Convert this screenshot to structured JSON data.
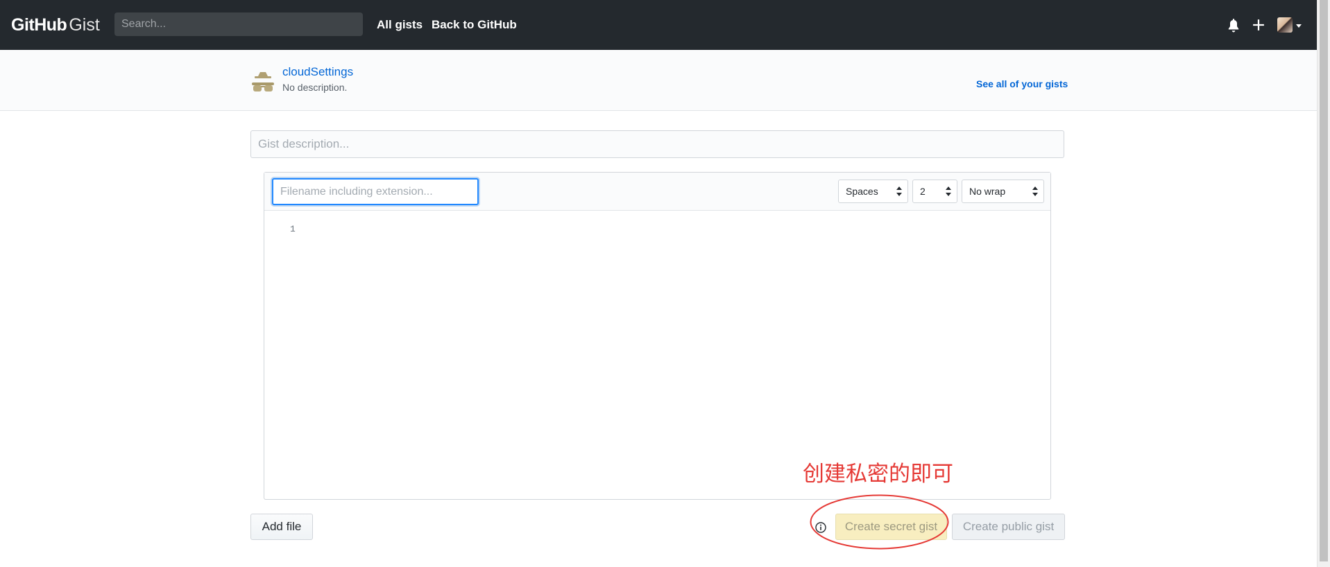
{
  "header": {
    "logo_github": "GitHub",
    "logo_gist": "Gist",
    "search_placeholder": "Search...",
    "nav": {
      "all_gists": "All gists",
      "back": "Back to GitHub"
    },
    "icons": [
      "bell-icon",
      "plus-icon",
      "avatar",
      "chevron-down-icon"
    ]
  },
  "gist": {
    "name": "cloudSettings",
    "description": "No description.",
    "see_all": "See all of your gists"
  },
  "form": {
    "description_placeholder": "Gist description...",
    "filename_placeholder": "Filename including extension...",
    "indent_mode": "Spaces",
    "indent_size": "2",
    "wrap_mode": "No wrap",
    "line_numbers": [
      "1"
    ]
  },
  "buttons": {
    "add_file": "Add file",
    "create_secret": "Create secret gist",
    "create_public": "Create public gist"
  },
  "annotation": {
    "text": "创建私密的即可",
    "color": "#e53935"
  },
  "colors": {
    "header_bg": "#24292e",
    "link": "#0366d6",
    "focus": "#2188ff"
  }
}
